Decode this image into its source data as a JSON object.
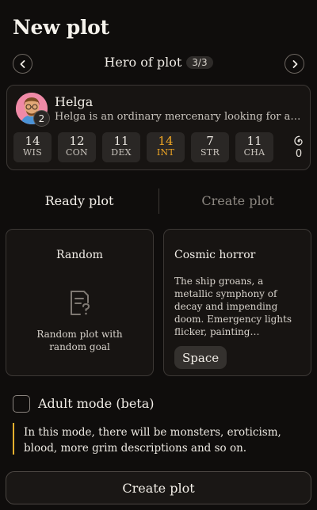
{
  "page": {
    "title": "New plot"
  },
  "hero_nav": {
    "title": "Hero of plot",
    "counter": "3/3"
  },
  "hero": {
    "name": "Helga",
    "level": "2",
    "description": "Helga is an ordinary mercenary looking for a…",
    "stats": [
      {
        "value": "14",
        "label": "WIS",
        "highlight": false
      },
      {
        "value": "12",
        "label": "CON",
        "highlight": false
      },
      {
        "value": "11",
        "label": "DEX",
        "highlight": false
      },
      {
        "value": "14",
        "label": "INT",
        "highlight": true
      },
      {
        "value": "7",
        "label": "STR",
        "highlight": false
      },
      {
        "value": "11",
        "label": "CHA",
        "highlight": false
      }
    ],
    "spiral": {
      "icon": "spiral-icon",
      "value": "0"
    }
  },
  "tabs": {
    "ready": "Ready plot",
    "create": "Create plot"
  },
  "cards": {
    "random": {
      "title": "Random",
      "icon": "document-question-icon",
      "desc": "Random plot with random goal"
    },
    "cosmic": {
      "title": "Cosmic horror",
      "desc": "The ship groans, a metallic symphony of decay and impending doom. Emergency lights flicker, painting…",
      "tag": "Space"
    }
  },
  "adult_mode": {
    "label": "Adult mode (beta)",
    "checked": false,
    "warning": "In this mode, there will be monsters, eroticism, blood, more grim descriptions and so on."
  },
  "footer": {
    "create_label": "Create plot"
  },
  "colors": {
    "background": "#0f0d0c",
    "accent": "#f2a825",
    "warning_bar": "#e7b02e"
  }
}
